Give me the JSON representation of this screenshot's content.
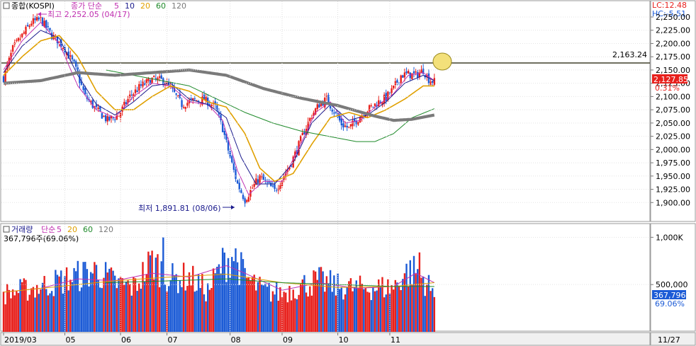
{
  "price_panel": {
    "checkbox_label": "종합(KOSPI)",
    "legend": [
      {
        "label": "종가 단순",
        "color": "#c02fb0"
      },
      {
        "label": "5",
        "color": "#c02fb0"
      },
      {
        "label": "10",
        "color": "#1a1a8c"
      },
      {
        "label": "20",
        "color": "#e0a000"
      },
      {
        "label": "60",
        "color": "#1f8a2a"
      },
      {
        "label": "120",
        "color": "#7a7a7a"
      }
    ],
    "lc_label": "LC:12.48",
    "hc_label": "HC:-5.51",
    "high_annotation": "최고 2,252.05 (04/17)",
    "low_annotation": "최저 1,891.81 (08/06)",
    "ref_line_label": "2,163.24",
    "current_price_label": "2,127.85",
    "current_change_label": "0.31%",
    "y_ticks": [
      "2,250.00",
      "2,225.00",
      "2,200.00",
      "2,175.00",
      "2,150.00",
      "2,125.00",
      "2,100.00",
      "2,075.00",
      "2,050.00",
      "2,025.00",
      "2,000.00",
      "1,975.00",
      "1,950.00",
      "1,925.00",
      "1,900.00"
    ],
    "colors": {
      "up": "#e8201c",
      "down": "#1c5bd6",
      "ref_line": "#1a1a00",
      "marker": "#f3e07a"
    }
  },
  "volume_panel": {
    "checkbox_label": "거래량",
    "legend": [
      {
        "label": "단순",
        "color": "#c02fb0"
      },
      {
        "label": "5",
        "color": "#c02fb0"
      },
      {
        "label": "20",
        "color": "#e0a000"
      },
      {
        "label": "60",
        "color": "#1f8a2a"
      },
      {
        "label": "120",
        "color": "#7a7a7a"
      }
    ],
    "value_label": "367,796주(69.06%)",
    "y_ticks": [
      "1,000K",
      "500,000"
    ],
    "current_volume_label": "367,796",
    "current_pct_label": "69.06%"
  },
  "x_axis": {
    "labels": [
      "2019/03",
      "05",
      "06",
      "07",
      "08",
      "09",
      "10",
      "11"
    ],
    "right_label": "11/27"
  },
  "chart_data": [
    {
      "type": "candlestick",
      "title": "종합(KOSPI)",
      "ylim": [
        1875,
        2262
      ],
      "reference_line": 2163.24,
      "high": {
        "value": 2252.05,
        "date": "04/17"
      },
      "low": {
        "value": 1891.81,
        "date": "08/06"
      },
      "last_close": 2127.85,
      "change_pct": 0.31,
      "x_months": [
        "2019/03",
        "05",
        "06",
        "07",
        "08",
        "09",
        "10",
        "11"
      ],
      "close_trajectory": [
        [
          0,
          2135
        ],
        [
          5,
          2190
        ],
        [
          10,
          2215
        ],
        [
          15,
          2240
        ],
        [
          20,
          2245
        ],
        [
          26,
          2215
        ],
        [
          32,
          2195
        ],
        [
          38,
          2160
        ],
        [
          44,
          2100
        ],
        [
          50,
          2075
        ],
        [
          56,
          2055
        ],
        [
          62,
          2065
        ],
        [
          68,
          2100
        ],
        [
          74,
          2120
        ],
        [
          80,
          2132
        ],
        [
          86,
          2130
        ],
        [
          90,
          2115
        ],
        [
          96,
          2085
        ],
        [
          102,
          2092
        ],
        [
          108,
          2095
        ],
        [
          114,
          2080
        ],
        [
          118,
          2040
        ],
        [
          122,
          1985
        ],
        [
          126,
          1935
        ],
        [
          130,
          1905
        ],
        [
          134,
          1928
        ],
        [
          138,
          1948
        ],
        [
          142,
          1935
        ],
        [
          146,
          1922
        ],
        [
          150,
          1945
        ],
        [
          154,
          1968
        ],
        [
          158,
          2000
        ],
        [
          162,
          2035
        ],
        [
          166,
          2065
        ],
        [
          170,
          2085
        ],
        [
          174,
          2095
        ],
        [
          178,
          2072
        ],
        [
          182,
          2048
        ],
        [
          186,
          2040
        ],
        [
          190,
          2055
        ],
        [
          194,
          2070
        ],
        [
          198,
          2080
        ],
        [
          202,
          2090
        ],
        [
          206,
          2098
        ],
        [
          210,
          2115
        ],
        [
          214,
          2140
        ],
        [
          218,
          2142
        ],
        [
          222,
          2140
        ],
        [
          226,
          2150
        ],
        [
          229,
          2132
        ],
        [
          232,
          2128
        ]
      ],
      "moving_averages": [
        {
          "name": "5",
          "values": [
            [
              0,
              2150
            ],
            [
              10,
              2205
            ],
            [
              20,
              2240
            ],
            [
              30,
              2200
            ],
            [
              40,
              2120
            ],
            [
              50,
              2075
            ],
            [
              60,
              2060
            ],
            [
              70,
              2100
            ],
            [
              80,
              2125
            ],
            [
              90,
              2120
            ],
            [
              100,
              2090
            ],
            [
              110,
              2085
            ],
            [
              118,
              2055
            ],
            [
              126,
              1960
            ],
            [
              132,
              1915
            ],
            [
              140,
              1940
            ],
            [
              150,
              1940
            ],
            [
              160,
              2010
            ],
            [
              168,
              2070
            ],
            [
              176,
              2090
            ],
            [
              184,
              2050
            ],
            [
              192,
              2055
            ],
            [
              200,
              2080
            ],
            [
              210,
              2105
            ],
            [
              218,
              2140
            ],
            [
              226,
              2145
            ],
            [
              232,
              2130
            ]
          ]
        },
        {
          "name": "10",
          "values": [
            [
              0,
              2145
            ],
            [
              10,
              2195
            ],
            [
              20,
              2225
            ],
            [
              30,
              2210
            ],
            [
              40,
              2140
            ],
            [
              50,
              2085
            ],
            [
              60,
              2065
            ],
            [
              70,
              2090
            ],
            [
              80,
              2120
            ],
            [
              90,
              2125
            ],
            [
              100,
              2095
            ],
            [
              110,
              2085
            ],
            [
              120,
              2060
            ],
            [
              128,
              1985
            ],
            [
              136,
              1935
            ],
            [
              146,
              1935
            ],
            [
              156,
              1975
            ],
            [
              166,
              2050
            ],
            [
              176,
              2085
            ],
            [
              186,
              2055
            ],
            [
              196,
              2065
            ],
            [
              206,
              2090
            ],
            [
              216,
              2125
            ],
            [
              226,
              2140
            ],
            [
              232,
              2130
            ]
          ]
        },
        {
          "name": "20",
          "values": [
            [
              0,
              2140
            ],
            [
              10,
              2175
            ],
            [
              20,
              2205
            ],
            [
              30,
              2215
            ],
            [
              40,
              2175
            ],
            [
              50,
              2110
            ],
            [
              60,
              2075
            ],
            [
              70,
              2075
            ],
            [
              80,
              2100
            ],
            [
              90,
              2120
            ],
            [
              100,
              2110
            ],
            [
              110,
              2090
            ],
            [
              120,
              2080
            ],
            [
              130,
              2030
            ],
            [
              138,
              1965
            ],
            [
              146,
              1940
            ],
            [
              156,
              1955
            ],
            [
              166,
              2010
            ],
            [
              176,
              2060
            ],
            [
              186,
              2070
            ],
            [
              196,
              2060
            ],
            [
              206,
              2075
            ],
            [
              216,
              2095
            ],
            [
              226,
              2120
            ],
            [
              232,
              2120
            ]
          ]
        },
        {
          "name": "60",
          "values": [
            [
              55,
              2150
            ],
            [
              70,
              2140
            ],
            [
              85,
              2130
            ],
            [
              100,
              2120
            ],
            [
              115,
              2095
            ],
            [
              130,
              2070
            ],
            [
              145,
              2050
            ],
            [
              160,
              2035
            ],
            [
              175,
              2025
            ],
            [
              190,
              2015
            ],
            [
              200,
              2015
            ],
            [
              210,
              2030
            ],
            [
              220,
              2060
            ],
            [
              232,
              2077
            ]
          ]
        },
        {
          "name": "120",
          "values": [
            [
              0,
              2125
            ],
            [
              20,
              2130
            ],
            [
              40,
              2145
            ],
            [
              60,
              2140
            ],
            [
              80,
              2145
            ],
            [
              100,
              2150
            ],
            [
              120,
              2140
            ],
            [
              140,
              2115
            ],
            [
              160,
              2097
            ],
            [
              180,
              2083
            ],
            [
              200,
              2063
            ],
            [
              210,
              2055
            ],
            [
              220,
              2057
            ],
            [
              232,
              2065
            ]
          ]
        }
      ]
    },
    {
      "type": "bar",
      "title": "거래량",
      "ylim": [
        0,
        1100000
      ],
      "last_value": 367796,
      "last_pct": 69.06,
      "volume_trajectory": [
        [
          0,
          400000
        ],
        [
          20,
          480000
        ],
        [
          40,
          590000
        ],
        [
          50,
          650000
        ],
        [
          60,
          520000
        ],
        [
          70,
          470000
        ],
        [
          80,
          750000
        ],
        [
          90,
          560000
        ],
        [
          100,
          580000
        ],
        [
          110,
          430000
        ],
        [
          118,
          720000
        ],
        [
          124,
          820000
        ],
        [
          130,
          580000
        ],
        [
          140,
          430000
        ],
        [
          150,
          410000
        ],
        [
          160,
          490000
        ],
        [
          170,
          540000
        ],
        [
          180,
          480000
        ],
        [
          190,
          460000
        ],
        [
          200,
          470000
        ],
        [
          210,
          470000
        ],
        [
          216,
          620000
        ],
        [
          222,
          650000
        ],
        [
          228,
          520000
        ],
        [
          232,
          370000
        ]
      ],
      "moving_averages": [
        {
          "name": "5",
          "values": [
            [
              0,
              420000
            ],
            [
              20,
              460000
            ],
            [
              40,
              560000
            ],
            [
              60,
              540000
            ],
            [
              80,
              620000
            ],
            [
              100,
              580000
            ],
            [
              120,
              700000
            ],
            [
              130,
              620000
            ],
            [
              150,
              440000
            ],
            [
              170,
              520000
            ],
            [
              190,
              460000
            ],
            [
              210,
              480000
            ],
            [
              222,
              620000
            ],
            [
              232,
              520000
            ]
          ]
        },
        {
          "name": "20",
          "values": [
            [
              0,
              420000
            ],
            [
              30,
              480000
            ],
            [
              60,
              540000
            ],
            [
              90,
              580000
            ],
            [
              120,
              610000
            ],
            [
              150,
              520000
            ],
            [
              180,
              470000
            ],
            [
              210,
              480000
            ],
            [
              232,
              520000
            ]
          ]
        },
        {
          "name": "60",
          "values": [
            [
              55,
              520000
            ],
            [
              90,
              540000
            ],
            [
              120,
              560000
            ],
            [
              150,
              520000
            ],
            [
              180,
              500000
            ],
            [
              210,
              480000
            ],
            [
              232,
              480000
            ]
          ]
        }
      ]
    }
  ]
}
